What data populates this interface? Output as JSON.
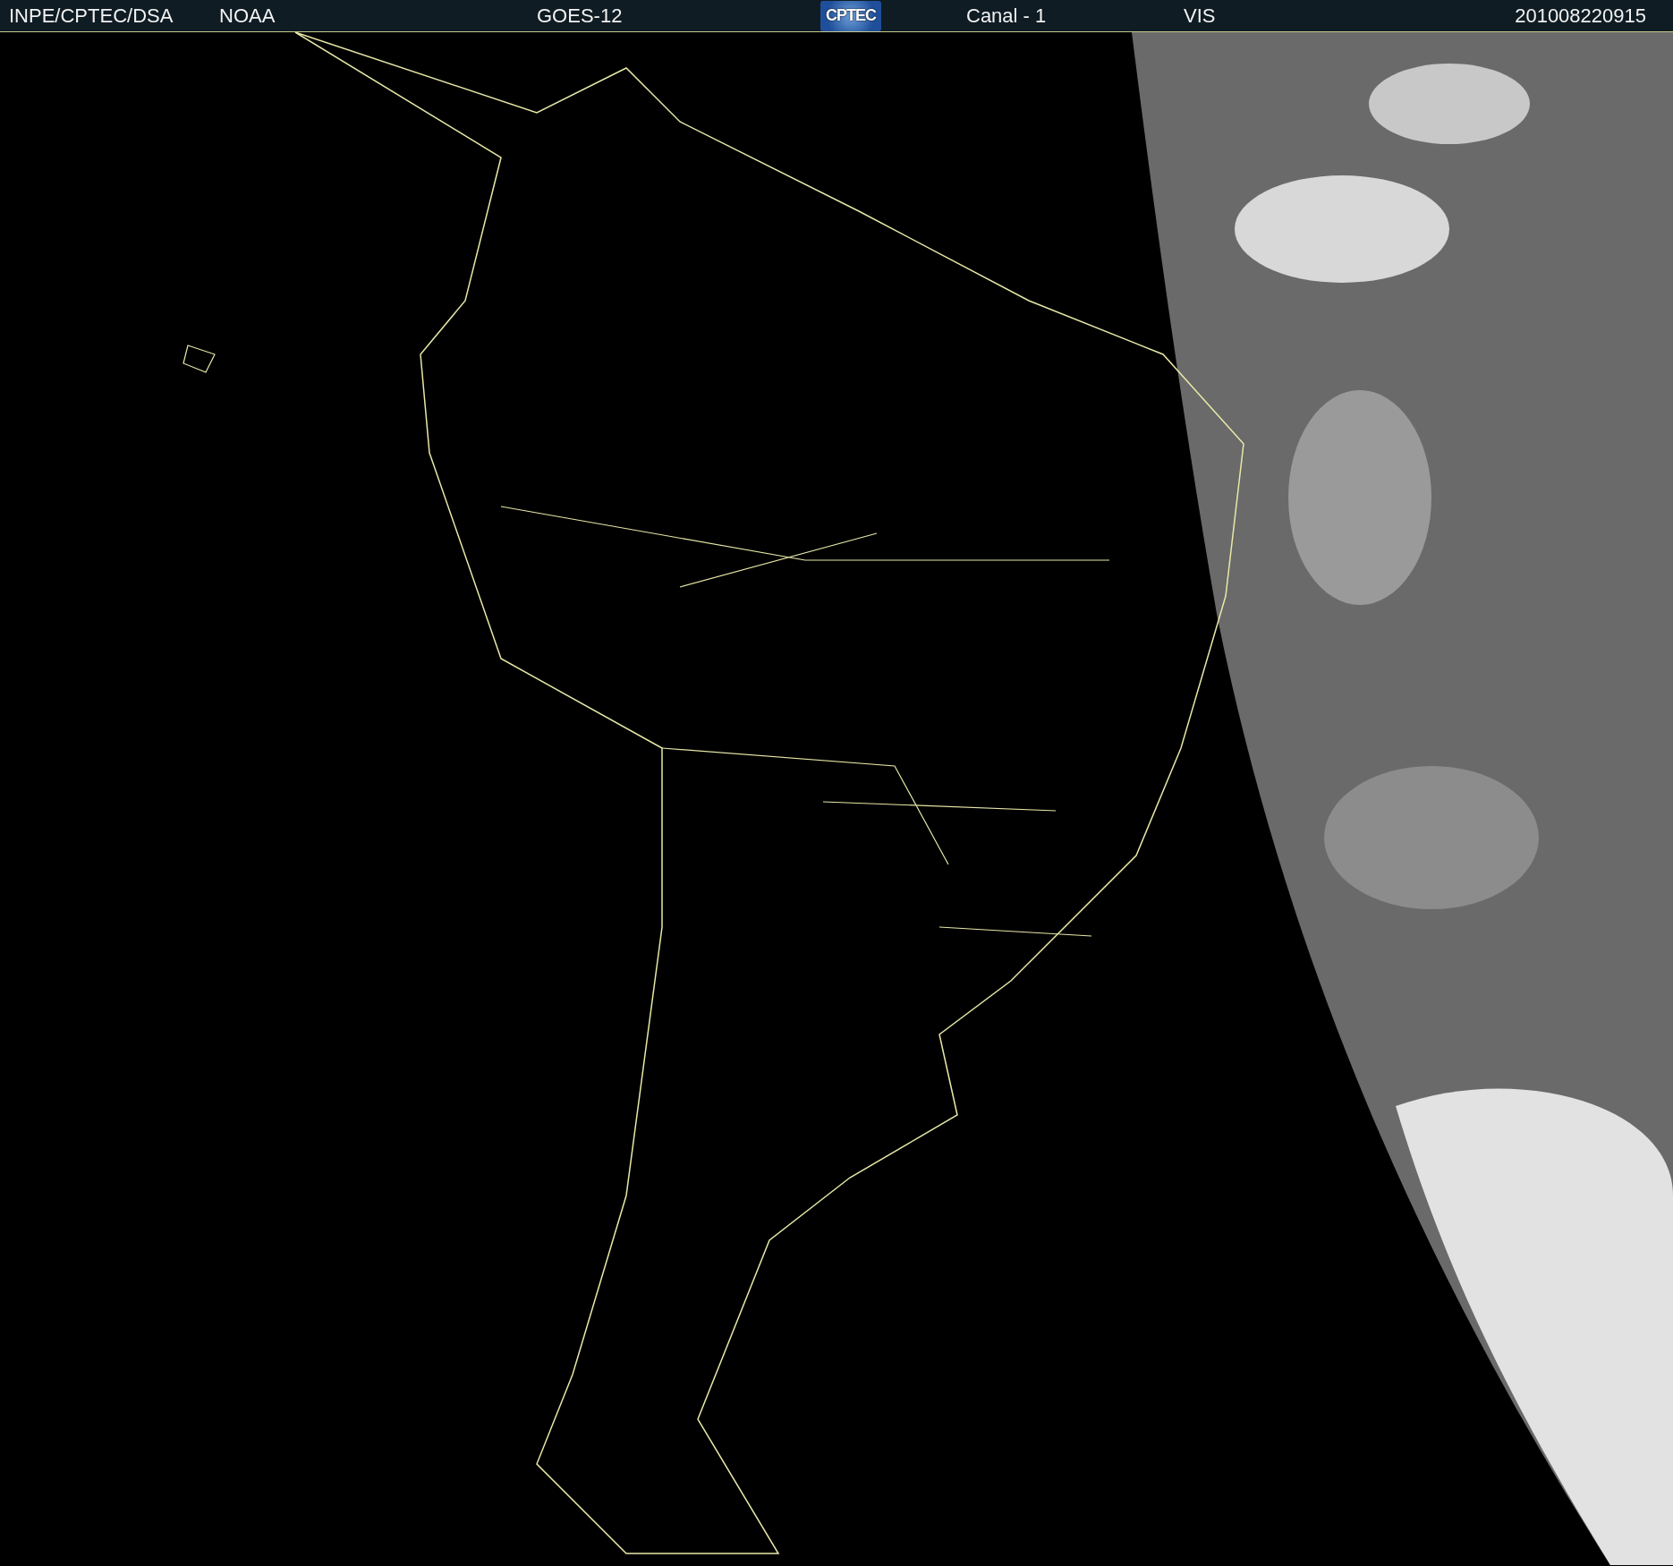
{
  "header": {
    "source": "INPE/CPTEC/DSA",
    "agency": "NOAA",
    "satellite": "GOES-12",
    "logo_text": "CPTEC",
    "channel": "Canal - 1",
    "band": "VIS",
    "timestamp": "201008220915"
  }
}
